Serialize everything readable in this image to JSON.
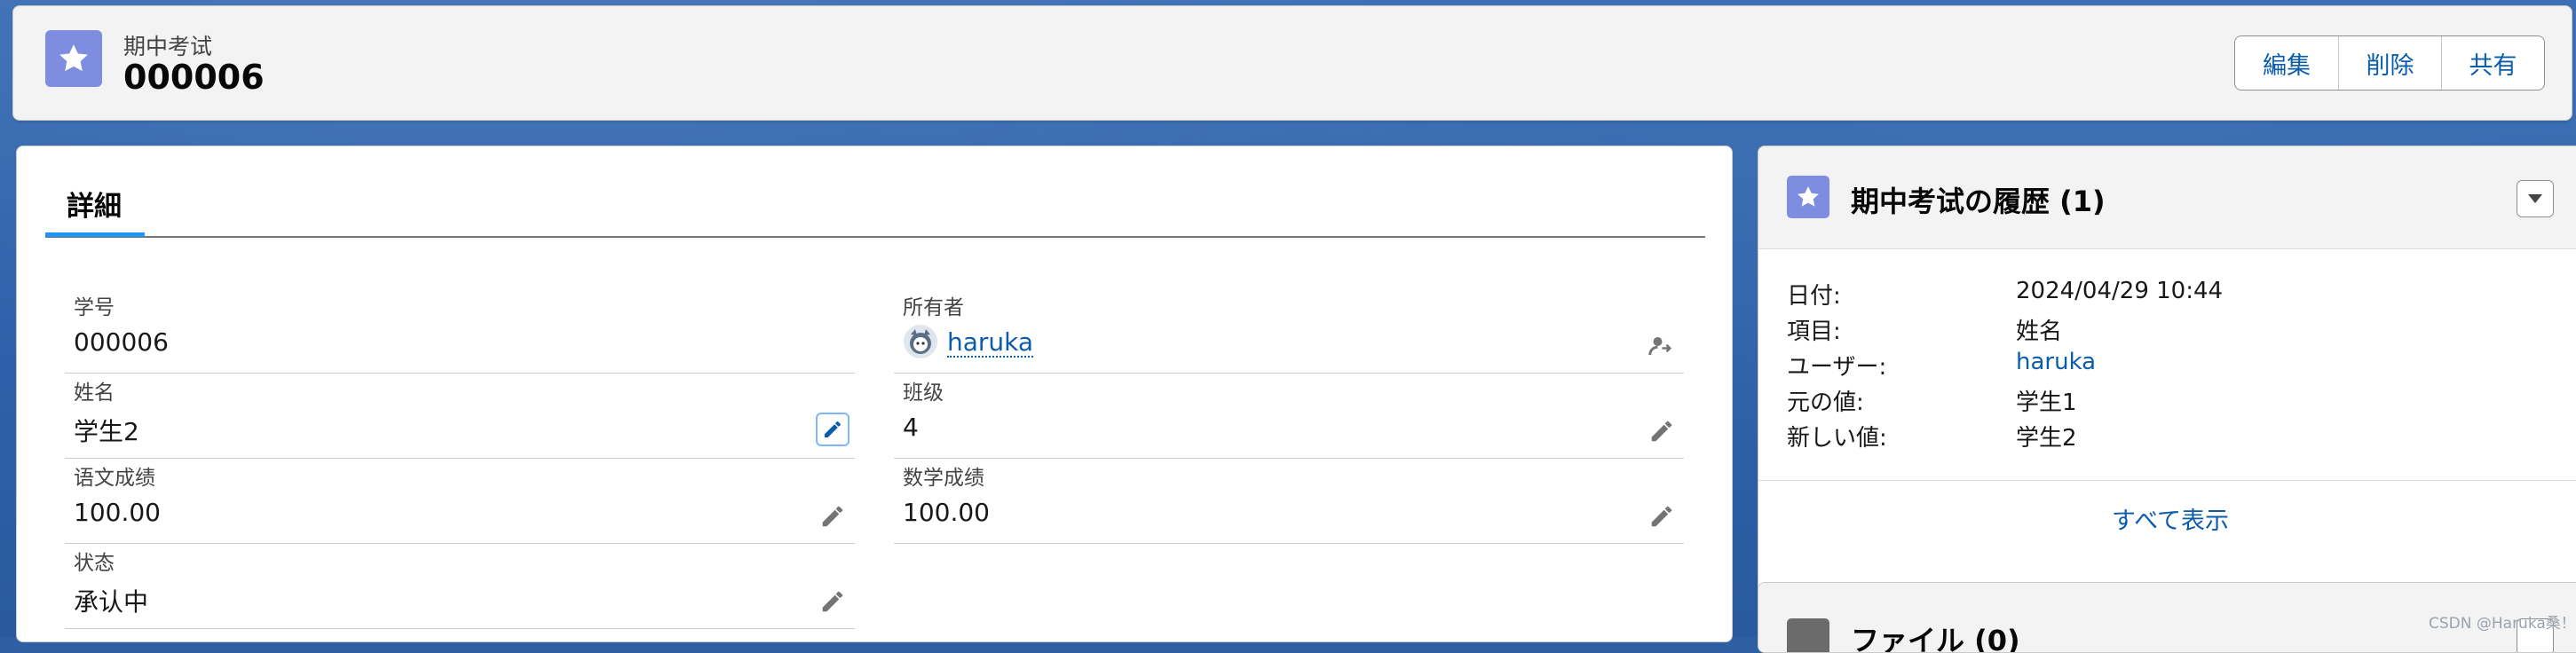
{
  "header": {
    "object_label": "期中考试",
    "record_name": "000006",
    "buttons": {
      "edit": "編集",
      "delete": "削除",
      "share": "共有"
    }
  },
  "detail": {
    "tab_label": "詳細",
    "fields": {
      "student_no": {
        "label": "学号",
        "value": "000006"
      },
      "owner": {
        "label": "所有者",
        "value": "haruka"
      },
      "name": {
        "label": "姓名",
        "value": "学生2"
      },
      "class": {
        "label": "班级",
        "value": "4"
      },
      "chinese_score": {
        "label": "语文成绩",
        "value": "100.00"
      },
      "math_score": {
        "label": "数学成绩",
        "value": "100.00"
      },
      "status": {
        "label": "状态",
        "value": "承认中"
      }
    }
  },
  "history": {
    "title": "期中考试の履歴 (1)",
    "rows": [
      {
        "key": "日付:",
        "value": "2024/04/29 10:44"
      },
      {
        "key": "項目:",
        "value": "姓名"
      },
      {
        "key": "ユーザー:",
        "value": "haruka"
      },
      {
        "key": "元の値:",
        "value": "学生1"
      },
      {
        "key": "新しい値:",
        "value": "学生2"
      }
    ],
    "view_all": "すべて表示"
  },
  "files": {
    "title": "ファイル (0)"
  },
  "watermark": "CSDN @Haruka桑！",
  "colors": {
    "accent_blue": "#0b5cab",
    "object_icon": "#7f8de1",
    "tab_active": "#1b96ff"
  },
  "icons": [
    "star-icon",
    "pencil-icon",
    "change-owner-icon",
    "chevron-down-icon",
    "file-icon",
    "avatar-icon"
  ]
}
